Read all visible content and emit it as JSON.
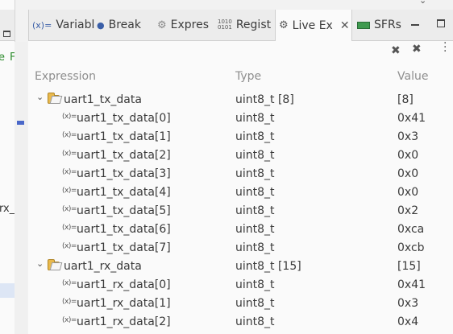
{
  "left_fragments": [
    "e",
    "F",
    "rx_"
  ],
  "tabs": [
    {
      "label": "Variabl",
      "icon": "variable-icon"
    },
    {
      "label": "Break",
      "icon": "breakpoint-icon"
    },
    {
      "label": "Expres",
      "icon": "expression-icon"
    },
    {
      "label": "Regist",
      "icon": "register-icon"
    },
    {
      "label": "Live Ex",
      "icon": "live-expression-icon",
      "active": true
    },
    {
      "label": "SFRs",
      "icon": "sfr-icon"
    }
  ],
  "columns": {
    "expression": "Expression",
    "type": "Type",
    "value": "Value"
  },
  "rows": [
    {
      "level": 0,
      "expandable": true,
      "name": "uart1_tx_data",
      "type": "uint8_t [8]",
      "value": "[8]"
    },
    {
      "level": 1,
      "name": "uart1_tx_data[0]",
      "type": "uint8_t",
      "value": "0x41"
    },
    {
      "level": 1,
      "name": "uart1_tx_data[1]",
      "type": "uint8_t",
      "value": "0x3"
    },
    {
      "level": 1,
      "name": "uart1_tx_data[2]",
      "type": "uint8_t",
      "value": "0x0"
    },
    {
      "level": 1,
      "name": "uart1_tx_data[3]",
      "type": "uint8_t",
      "value": "0x0"
    },
    {
      "level": 1,
      "name": "uart1_tx_data[4]",
      "type": "uint8_t",
      "value": "0x0"
    },
    {
      "level": 1,
      "name": "uart1_tx_data[5]",
      "type": "uint8_t",
      "value": "0x2"
    },
    {
      "level": 1,
      "name": "uart1_tx_data[6]",
      "type": "uint8_t",
      "value": "0xca"
    },
    {
      "level": 1,
      "name": "uart1_tx_data[7]",
      "type": "uint8_t",
      "value": "0xcb"
    },
    {
      "level": 0,
      "expandable": true,
      "name": "uart1_rx_data",
      "type": "uint8_t [15]",
      "value": "[15]"
    },
    {
      "level": 1,
      "name": "uart1_rx_data[0]",
      "type": "uint8_t",
      "value": "0x41"
    },
    {
      "level": 1,
      "name": "uart1_rx_data[1]",
      "type": "uint8_t",
      "value": "0x3"
    },
    {
      "level": 1,
      "name": "uart1_rx_data[2]",
      "type": "uint8_t",
      "value": "0x4"
    }
  ]
}
